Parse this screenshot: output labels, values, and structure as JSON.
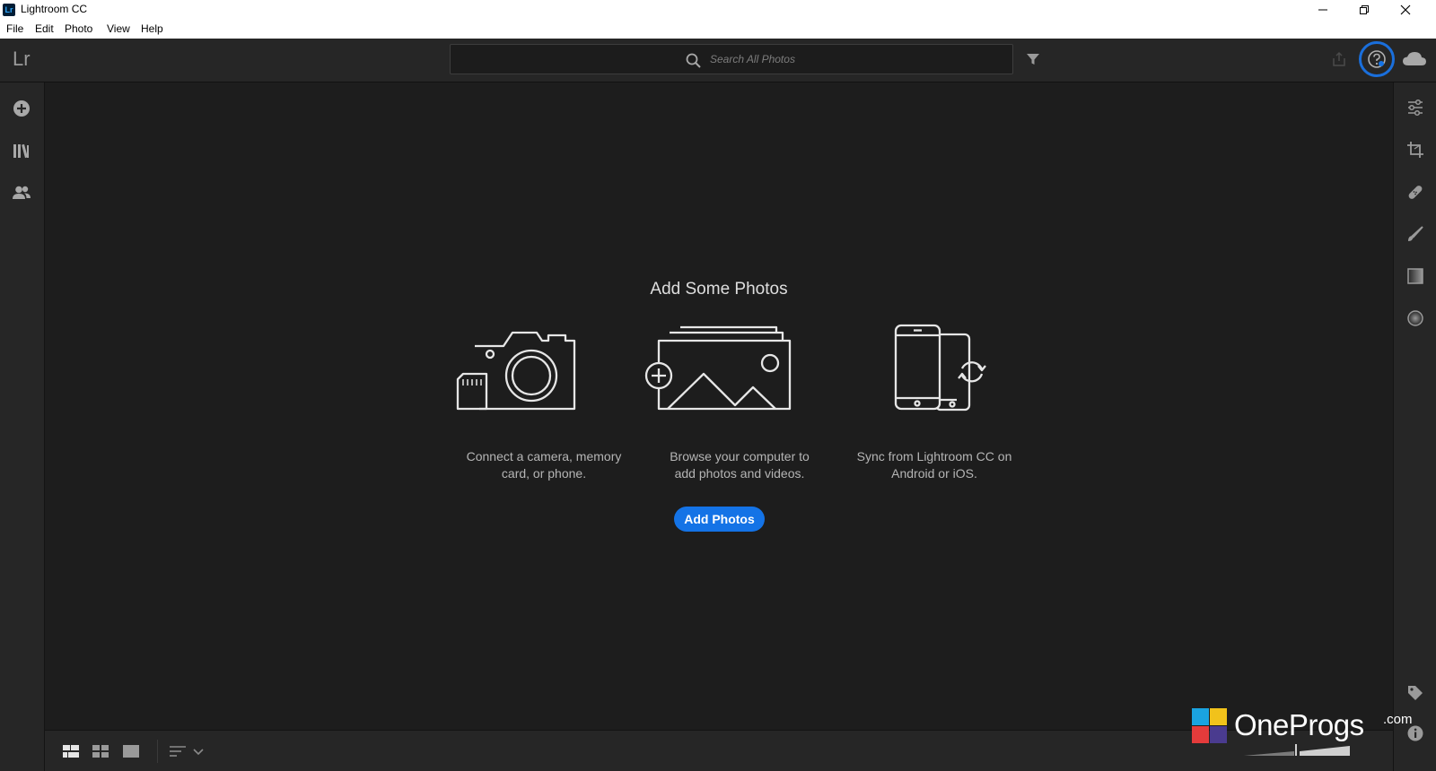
{
  "window": {
    "title": "Lightroom CC",
    "app_icon_text": "Lr"
  },
  "menu": {
    "items": [
      "File",
      "Edit",
      "Photo",
      "View",
      "Help"
    ]
  },
  "toolbar": {
    "logo": "Lr",
    "search_placeholder": "Search All Photos"
  },
  "main": {
    "headline": "Add Some Photos",
    "options": [
      {
        "icon": "camera-icon",
        "text_line1": "Connect a camera, memory",
        "text_line2": "card, or phone."
      },
      {
        "icon": "add-image-icon",
        "text_line1": "Browse your computer to",
        "text_line2": "add photos and videos."
      },
      {
        "icon": "phone-sync-icon",
        "text_line1": "Sync from Lightroom CC on",
        "text_line2": "Android or iOS."
      }
    ],
    "add_button": "Add Photos"
  },
  "left_rail": [
    "add-icon",
    "library-icon",
    "people-icon"
  ],
  "right_rail": [
    "edit-sliders-icon",
    "crop-icon",
    "healing-icon",
    "brush-icon",
    "linear-gradient-icon",
    "radial-gradient-icon",
    "tag-icon",
    "info-icon"
  ],
  "watermark": {
    "name": "OneProgs",
    "suffix": ".com"
  },
  "colors": {
    "accent": "#1473e6",
    "background": "#1d1d1d",
    "panel": "#262626",
    "help_highlight": "#1a6fdc"
  }
}
